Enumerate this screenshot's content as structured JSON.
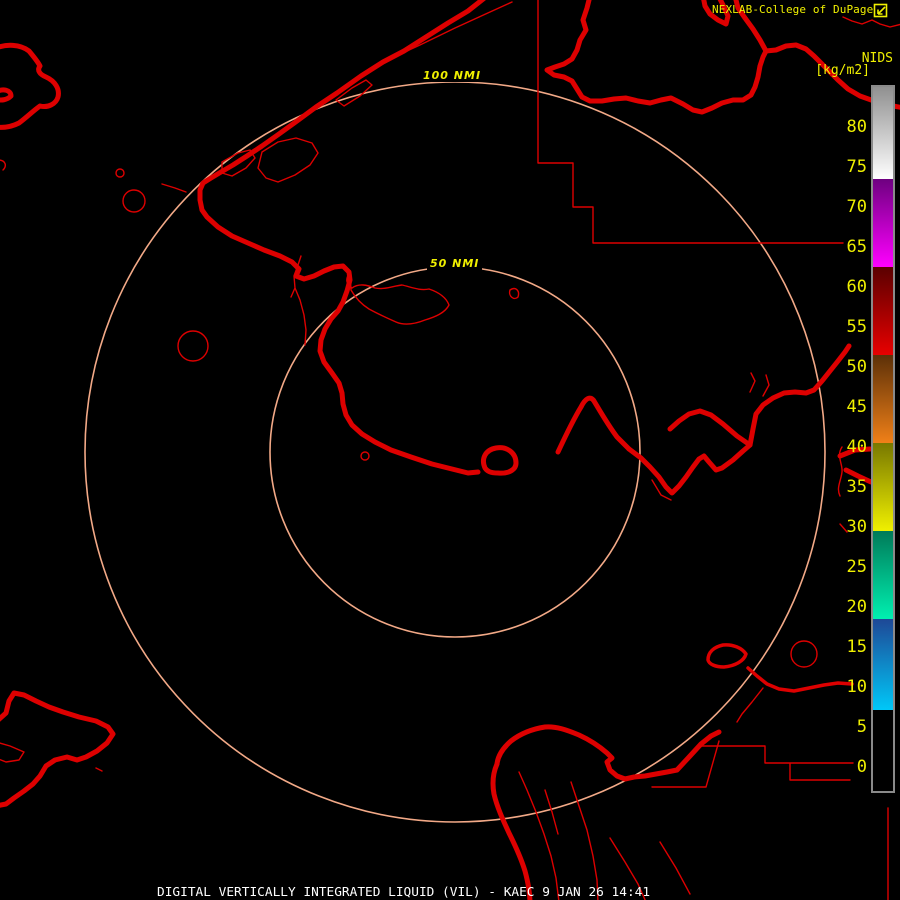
{
  "header": {
    "title": "NEXLAB-College of DuPage",
    "logo_icon": "cod-weather-vane-icon"
  },
  "product_panel": {
    "system_label": "NIDS",
    "units_label": "[kg/m2]"
  },
  "colorbar": {
    "tick_labels": [
      "80",
      "75",
      "70",
      "65",
      "60",
      "55",
      "50",
      "45",
      "40",
      "35",
      "30",
      "25",
      "20",
      "15",
      "10",
      "5",
      "0"
    ],
    "scale_bands": [
      {
        "from": 85,
        "to": 74,
        "colors": [
          "#909090",
          "#ffffff"
        ],
        "name": "gray"
      },
      {
        "from": 74,
        "to": 62.5,
        "colors": [
          "#6e0080",
          "#ff00ff"
        ],
        "name": "purple-magenta"
      },
      {
        "from": 62.5,
        "to": 51.5,
        "colors": [
          "#5a0000",
          "#e80000"
        ],
        "name": "dark-red-red"
      },
      {
        "from": 51.5,
        "to": 40.5,
        "colors": [
          "#5c3008",
          "#f08018"
        ],
        "name": "brown-orange"
      },
      {
        "from": 40.5,
        "to": 29.5,
        "colors": [
          "#787800",
          "#f0f000"
        ],
        "name": "olive-yellow"
      },
      {
        "from": 29.5,
        "to": 18.5,
        "colors": [
          "#007a58",
          "#00f0b0"
        ],
        "name": "teal-green"
      },
      {
        "from": 18.5,
        "to": 7.5,
        "colors": [
          "#1e4896",
          "#00c8f8"
        ],
        "name": "blue-cyan"
      },
      {
        "from": 7.5,
        "to": -3,
        "colors": [
          "#000000",
          "#000000"
        ],
        "name": "black"
      }
    ]
  },
  "range_rings": {
    "outer_label": "100 NMI",
    "inner_label": "50 NMI"
  },
  "footer": {
    "product_title": "DIGITAL VERTICALLY INTEGRATED LIQUID (VIL) - KAEC 9 JAN 26 14:41"
  },
  "colors": {
    "background": "#000000",
    "map_outline": "#dd0000",
    "range_ring": "#f2a987",
    "label_yellow": "#f0f000",
    "footer_text": "#ffffff",
    "colorbar_border": "#8a8a8a"
  }
}
